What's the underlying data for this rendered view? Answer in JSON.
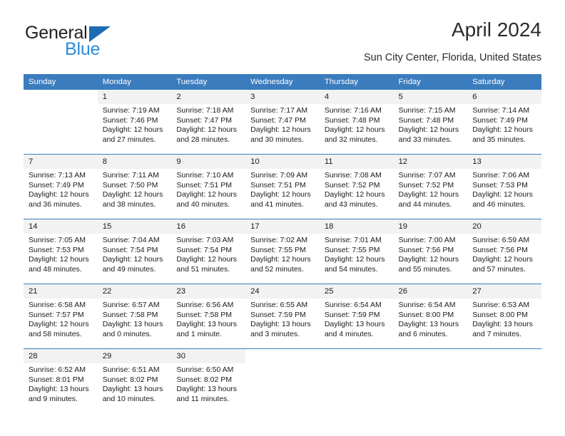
{
  "brand": {
    "name_part1": "General",
    "name_part2": "Blue",
    "color_dark": "#231f20",
    "color_blue": "#2e8bd8",
    "triangle_color": "#1c6cb5"
  },
  "header": {
    "title": "April 2024",
    "subtitle": "Sun City Center, Florida, United States"
  },
  "theme": {
    "header_bg": "#3a7cbe",
    "header_text": "#ffffff",
    "daynum_bg": "#f2f2f2",
    "grid_line": "#3a7cbe"
  },
  "weekdays": [
    "Sunday",
    "Monday",
    "Tuesday",
    "Wednesday",
    "Thursday",
    "Friday",
    "Saturday"
  ],
  "weeks": [
    [
      {
        "day": ""
      },
      {
        "day": "1",
        "sunrise": "Sunrise: 7:19 AM",
        "sunset": "Sunset: 7:46 PM",
        "daylight": "Daylight: 12 hours and 27 minutes."
      },
      {
        "day": "2",
        "sunrise": "Sunrise: 7:18 AM",
        "sunset": "Sunset: 7:47 PM",
        "daylight": "Daylight: 12 hours and 28 minutes."
      },
      {
        "day": "3",
        "sunrise": "Sunrise: 7:17 AM",
        "sunset": "Sunset: 7:47 PM",
        "daylight": "Daylight: 12 hours and 30 minutes."
      },
      {
        "day": "4",
        "sunrise": "Sunrise: 7:16 AM",
        "sunset": "Sunset: 7:48 PM",
        "daylight": "Daylight: 12 hours and 32 minutes."
      },
      {
        "day": "5",
        "sunrise": "Sunrise: 7:15 AM",
        "sunset": "Sunset: 7:48 PM",
        "daylight": "Daylight: 12 hours and 33 minutes."
      },
      {
        "day": "6",
        "sunrise": "Sunrise: 7:14 AM",
        "sunset": "Sunset: 7:49 PM",
        "daylight": "Daylight: 12 hours and 35 minutes."
      }
    ],
    [
      {
        "day": "7",
        "sunrise": "Sunrise: 7:13 AM",
        "sunset": "Sunset: 7:49 PM",
        "daylight": "Daylight: 12 hours and 36 minutes."
      },
      {
        "day": "8",
        "sunrise": "Sunrise: 7:11 AM",
        "sunset": "Sunset: 7:50 PM",
        "daylight": "Daylight: 12 hours and 38 minutes."
      },
      {
        "day": "9",
        "sunrise": "Sunrise: 7:10 AM",
        "sunset": "Sunset: 7:51 PM",
        "daylight": "Daylight: 12 hours and 40 minutes."
      },
      {
        "day": "10",
        "sunrise": "Sunrise: 7:09 AM",
        "sunset": "Sunset: 7:51 PM",
        "daylight": "Daylight: 12 hours and 41 minutes."
      },
      {
        "day": "11",
        "sunrise": "Sunrise: 7:08 AM",
        "sunset": "Sunset: 7:52 PM",
        "daylight": "Daylight: 12 hours and 43 minutes."
      },
      {
        "day": "12",
        "sunrise": "Sunrise: 7:07 AM",
        "sunset": "Sunset: 7:52 PM",
        "daylight": "Daylight: 12 hours and 44 minutes."
      },
      {
        "day": "13",
        "sunrise": "Sunrise: 7:06 AM",
        "sunset": "Sunset: 7:53 PM",
        "daylight": "Daylight: 12 hours and 46 minutes."
      }
    ],
    [
      {
        "day": "14",
        "sunrise": "Sunrise: 7:05 AM",
        "sunset": "Sunset: 7:53 PM",
        "daylight": "Daylight: 12 hours and 48 minutes."
      },
      {
        "day": "15",
        "sunrise": "Sunrise: 7:04 AM",
        "sunset": "Sunset: 7:54 PM",
        "daylight": "Daylight: 12 hours and 49 minutes."
      },
      {
        "day": "16",
        "sunrise": "Sunrise: 7:03 AM",
        "sunset": "Sunset: 7:54 PM",
        "daylight": "Daylight: 12 hours and 51 minutes."
      },
      {
        "day": "17",
        "sunrise": "Sunrise: 7:02 AM",
        "sunset": "Sunset: 7:55 PM",
        "daylight": "Daylight: 12 hours and 52 minutes."
      },
      {
        "day": "18",
        "sunrise": "Sunrise: 7:01 AM",
        "sunset": "Sunset: 7:55 PM",
        "daylight": "Daylight: 12 hours and 54 minutes."
      },
      {
        "day": "19",
        "sunrise": "Sunrise: 7:00 AM",
        "sunset": "Sunset: 7:56 PM",
        "daylight": "Daylight: 12 hours and 55 minutes."
      },
      {
        "day": "20",
        "sunrise": "Sunrise: 6:59 AM",
        "sunset": "Sunset: 7:56 PM",
        "daylight": "Daylight: 12 hours and 57 minutes."
      }
    ],
    [
      {
        "day": "21",
        "sunrise": "Sunrise: 6:58 AM",
        "sunset": "Sunset: 7:57 PM",
        "daylight": "Daylight: 12 hours and 58 minutes."
      },
      {
        "day": "22",
        "sunrise": "Sunrise: 6:57 AM",
        "sunset": "Sunset: 7:58 PM",
        "daylight": "Daylight: 13 hours and 0 minutes."
      },
      {
        "day": "23",
        "sunrise": "Sunrise: 6:56 AM",
        "sunset": "Sunset: 7:58 PM",
        "daylight": "Daylight: 13 hours and 1 minute."
      },
      {
        "day": "24",
        "sunrise": "Sunrise: 6:55 AM",
        "sunset": "Sunset: 7:59 PM",
        "daylight": "Daylight: 13 hours and 3 minutes."
      },
      {
        "day": "25",
        "sunrise": "Sunrise: 6:54 AM",
        "sunset": "Sunset: 7:59 PM",
        "daylight": "Daylight: 13 hours and 4 minutes."
      },
      {
        "day": "26",
        "sunrise": "Sunrise: 6:54 AM",
        "sunset": "Sunset: 8:00 PM",
        "daylight": "Daylight: 13 hours and 6 minutes."
      },
      {
        "day": "27",
        "sunrise": "Sunrise: 6:53 AM",
        "sunset": "Sunset: 8:00 PM",
        "daylight": "Daylight: 13 hours and 7 minutes."
      }
    ],
    [
      {
        "day": "28",
        "sunrise": "Sunrise: 6:52 AM",
        "sunset": "Sunset: 8:01 PM",
        "daylight": "Daylight: 13 hours and 9 minutes."
      },
      {
        "day": "29",
        "sunrise": "Sunrise: 6:51 AM",
        "sunset": "Sunset: 8:02 PM",
        "daylight": "Daylight: 13 hours and 10 minutes."
      },
      {
        "day": "30",
        "sunrise": "Sunrise: 6:50 AM",
        "sunset": "Sunset: 8:02 PM",
        "daylight": "Daylight: 13 hours and 11 minutes."
      },
      {
        "day": ""
      },
      {
        "day": ""
      },
      {
        "day": ""
      },
      {
        "day": ""
      }
    ]
  ]
}
